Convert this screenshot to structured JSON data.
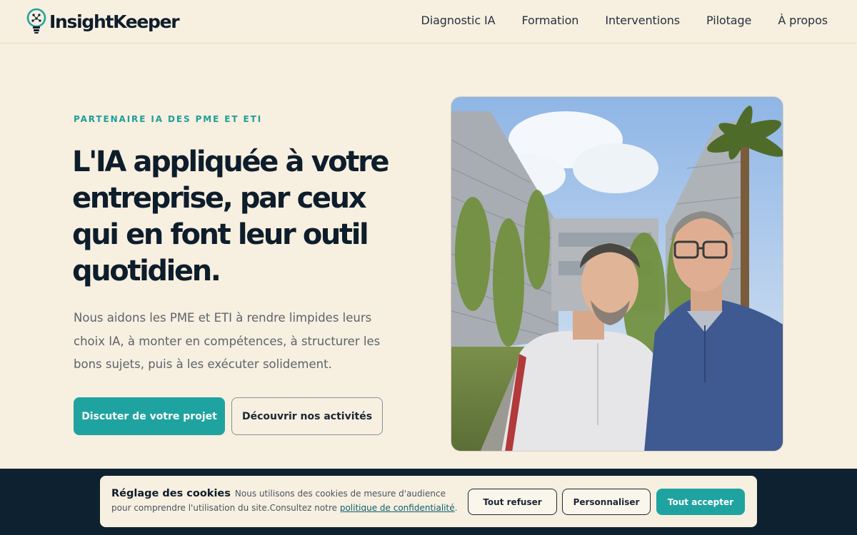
{
  "brand": {
    "name": "InsightKeeper",
    "accent": "#1fa3a0",
    "logo_icon": "lightbulb-circuit-icon"
  },
  "nav": {
    "items": [
      {
        "label": "Diagnostic IA"
      },
      {
        "label": "Formation"
      },
      {
        "label": "Interventions"
      },
      {
        "label": "Pilotage"
      },
      {
        "label": "À propos"
      }
    ]
  },
  "hero": {
    "eyebrow": "PARTENAIRE IA DES PME ET ETI",
    "headline": "L'IA appliquée à votre entreprise, par ceux qui en font leur outil quotidien.",
    "lead": "Nous aidons les PME et ETI à rendre limpides leurs choix IA, à monter en compétences, à structurer les bons sujets, puis à les exécuter solidement.",
    "primary_cta": "Discuter de votre projet",
    "secondary_cta": "Découvrir nos activités",
    "photo_icon": "founders-photo"
  },
  "cookie": {
    "title": "Réglage des cookies",
    "body": "Nous utilisons des cookies de mesure d'audience pour comprendre l'utilisation du site.Consultez notre",
    "link": "politique de confidentialité",
    "link_suffix": ".",
    "refuse": "Tout refuser",
    "customize": "Personnaliser",
    "accept": "Tout accepter"
  }
}
